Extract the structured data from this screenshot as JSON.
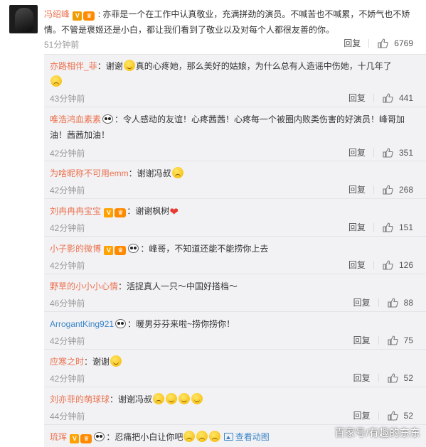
{
  "main": {
    "username": "冯绍峰",
    "text": ": 亦菲是一个在工作中认真敬业，充满拼劲的演员。不喊苦也不喊累，不娇气也不矫情。不管是褒姬还是小白，都让我们看到了敬业以及对每个人都很友善的你。",
    "time": "51分钟前",
    "reply_label": "回复",
    "likes": "6769"
  },
  "replies": [
    {
      "username": "亦路相伴_菲",
      "text_a": "：谢谢",
      "text_b": "真的心疼她，那么美好的姑娘，为什么总有人造谣中伤她，十几年了",
      "time": "43分钟前",
      "reply_label": "回复",
      "likes": "441"
    },
    {
      "username": "唯浩鸿血素素",
      "text_a": "：令人感动的友谊！心疼茜茜！心疼每一个被圈内败类伤害的好演员！峰哥加油！茜茜加油！",
      "time": "42分钟前",
      "reply_label": "回复",
      "likes": "351"
    },
    {
      "username": "为啥昵称不可用emm",
      "text_a": "：谢谢冯叔",
      "time": "42分钟前",
      "reply_label": "回复",
      "likes": "268"
    },
    {
      "username": "刘冉冉冉宝宝",
      "text_a": "：谢谢枫树",
      "time": "42分钟前",
      "reply_label": "回复",
      "likes": "151"
    },
    {
      "username": "小子影的微博",
      "text_a": "：峰哥，不知道还能不能捞你上去",
      "time": "42分钟前",
      "reply_label": "回复",
      "likes": "126"
    },
    {
      "username": "野草的小小小心情",
      "text_a": "：活捉真人一只～中国好搭档～",
      "time": "46分钟前",
      "reply_label": "回复",
      "likes": "88"
    },
    {
      "username": "ArrogantKing921",
      "text_a": "：暖男芬芬来啦~捞你捞你！",
      "time": "42分钟前",
      "reply_label": "回复",
      "likes": "75"
    },
    {
      "username": "应寒之时",
      "text_a": "：谢谢",
      "time": "42分钟前",
      "reply_label": "回复",
      "likes": "52"
    },
    {
      "username": "刘亦菲的萌球球",
      "text_a": "：谢谢冯叔",
      "time": "44分钟前",
      "reply_label": "回复",
      "likes": "52"
    },
    {
      "username": "琉珲",
      "text_a": "：忍痛把小白让你吧",
      "pic_link": "查看动图"
    }
  ],
  "watermark": "百家号/有趣的东东",
  "icons": [
    "v-badge",
    "crown-badge",
    "panda-emoji",
    "smile-emoji",
    "sad-emoji",
    "heart-emoji",
    "thumb-up-icon",
    "picture-icon"
  ],
  "colors": {
    "username": "#eb7350",
    "link": "#3c86c7",
    "reply_bg": "#f2f2f5",
    "time": "#999999"
  }
}
